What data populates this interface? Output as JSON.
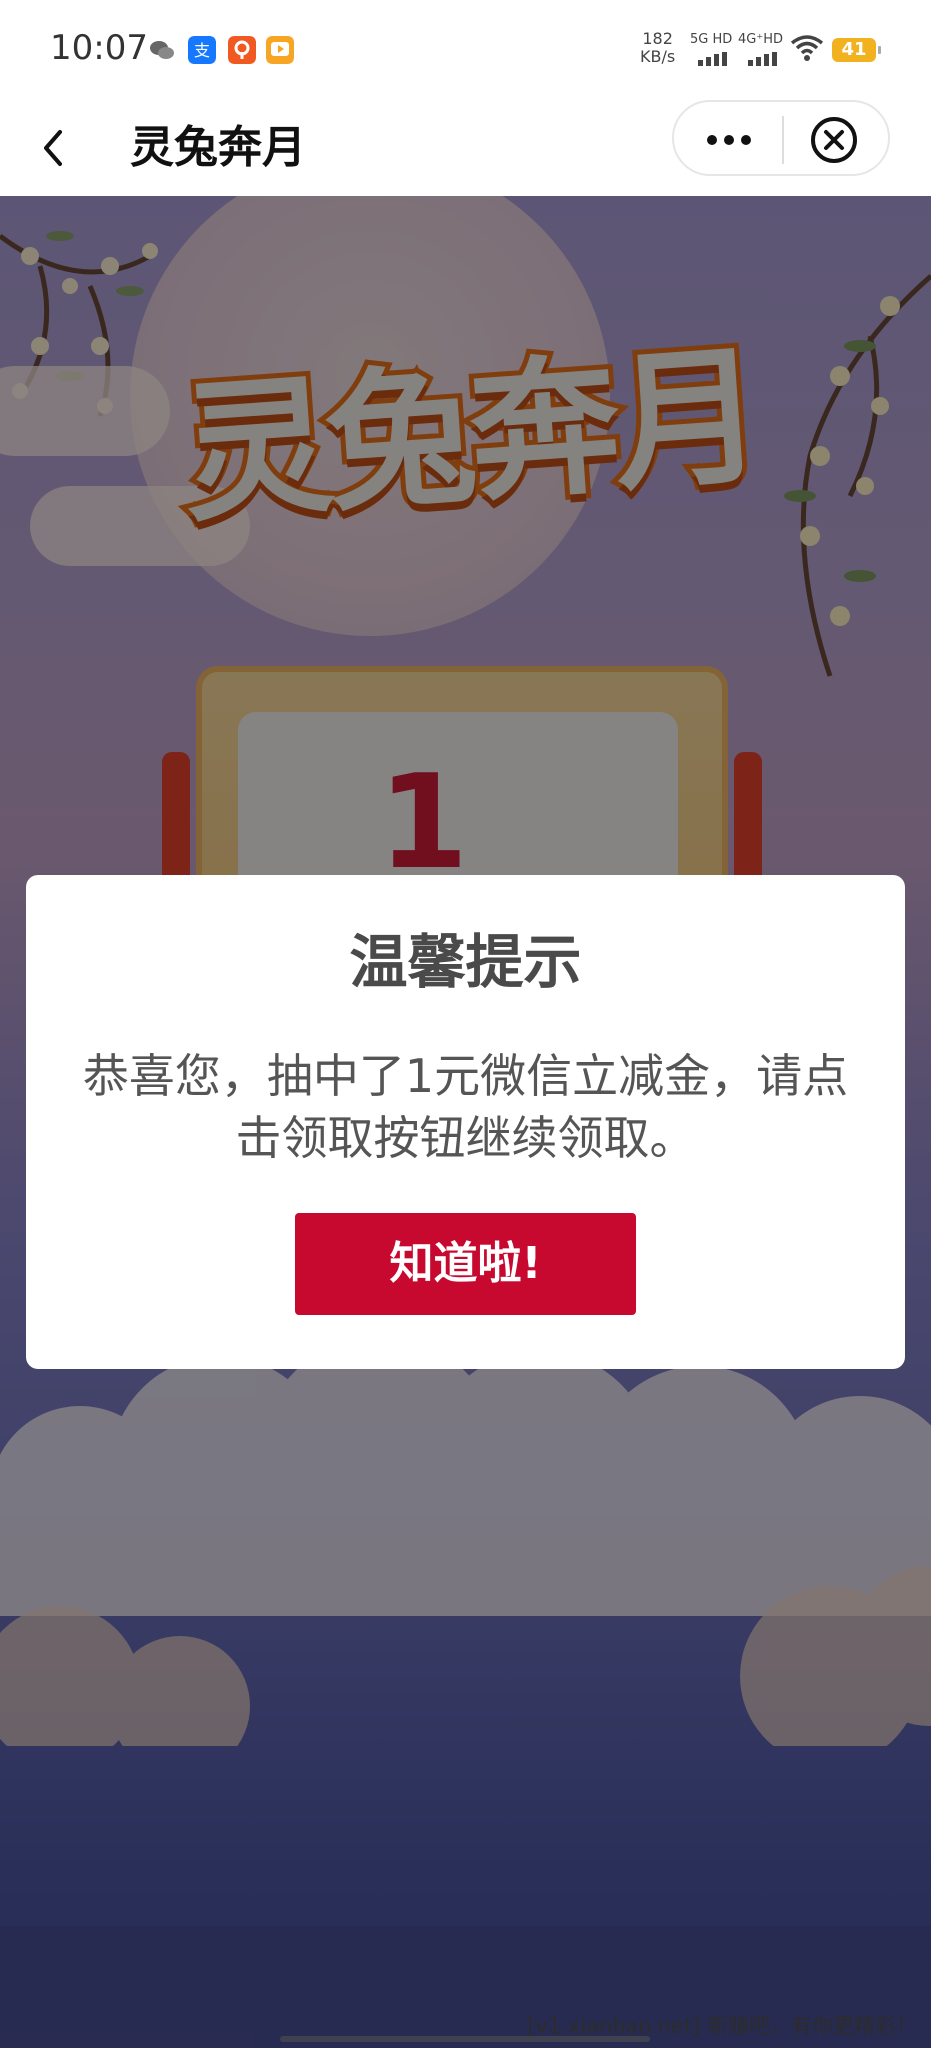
{
  "status_bar": {
    "time": "10:07",
    "net_speed_value": "182",
    "net_speed_unit": "KB/s",
    "sim1_label": "5G HD",
    "sim2_label": "4G⁺HD",
    "battery": "41",
    "app_icons": [
      "wechat-icon",
      "alipay-icon",
      "orange-app-icon",
      "video-app-icon"
    ]
  },
  "nav": {
    "title": "灵兔奔月",
    "back_icon": "chevron-left-icon",
    "more_icon": "more-dots-icon",
    "close_icon": "close-circle-icon"
  },
  "hero": {
    "title": "灵兔奔月",
    "calendar_number": "1"
  },
  "modal": {
    "title": "温馨提示",
    "message": "恭喜您，抽中了1元微信立减金，请点击领取按钮继续领取。",
    "button": "知道啦!"
  },
  "watermark": "[v1.xianbao.net] 新赚吧，有你更精彩！",
  "colors": {
    "primary_button": "#c8092f",
    "hero_title_stroke": "#e9721d",
    "battery": "#f2b21f"
  }
}
